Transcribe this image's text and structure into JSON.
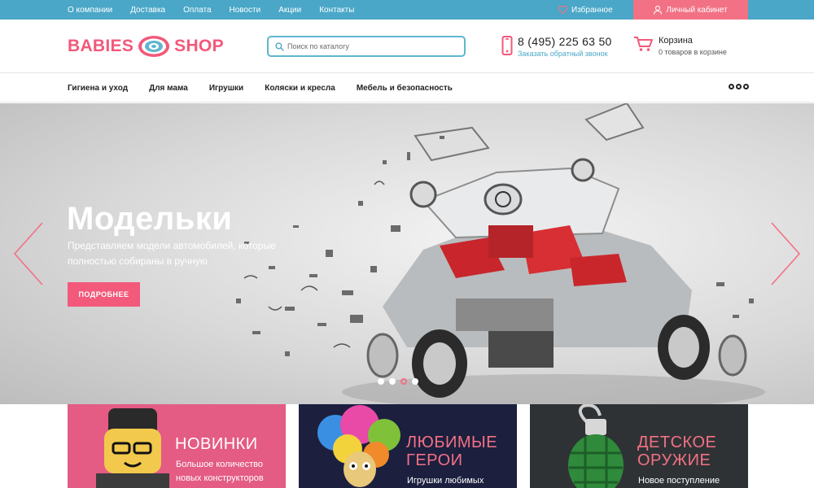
{
  "topbar": {
    "links": [
      "О компании",
      "Доставка",
      "Оплата",
      "Новости",
      "Акции",
      "Контакты"
    ],
    "favorites_label": "Избранное",
    "cabinet_label": "Личный кабинет"
  },
  "header": {
    "logo_left": "BABIES",
    "logo_right": "SHOP",
    "search_placeholder": "Поиск по каталогу",
    "phone_number": "8 (495) 225 63 50",
    "callback_label": "Заказать обратный звонок",
    "cart_title": "Корзина",
    "cart_status": "0 товаров в корзине"
  },
  "categories": [
    "Гигиена и уход",
    "Для мама",
    "Игрушки",
    "Коляски и кресла",
    "Мебель и безопасность"
  ],
  "hero": {
    "title": "Модельки",
    "text": "Представляем модели автомобилей, которые полностью собираны в ручную",
    "button_label": "ПОДРОБНЕЕ",
    "slide_count": 4,
    "active_slide": 3
  },
  "cards": [
    {
      "title_line1": "НОВИНКИ",
      "title_line2": "",
      "sub_line1": "Большое количество",
      "sub_line2": "новых конструкторов"
    },
    {
      "title_line1": "ЛЮБИМЫЕ",
      "title_line2": "ГЕРОИ",
      "sub_line1": "Игрушки любимых",
      "sub_line2": ""
    },
    {
      "title_line1": "ДЕТСКОЕ",
      "title_line2": "ОРУЖИЕ",
      "sub_line1": "Новое поступление",
      "sub_line2": ""
    }
  ],
  "colors": {
    "topbar": "#4aa7c8",
    "accent_pink": "#f27184",
    "logo_pink": "#f2597a"
  }
}
